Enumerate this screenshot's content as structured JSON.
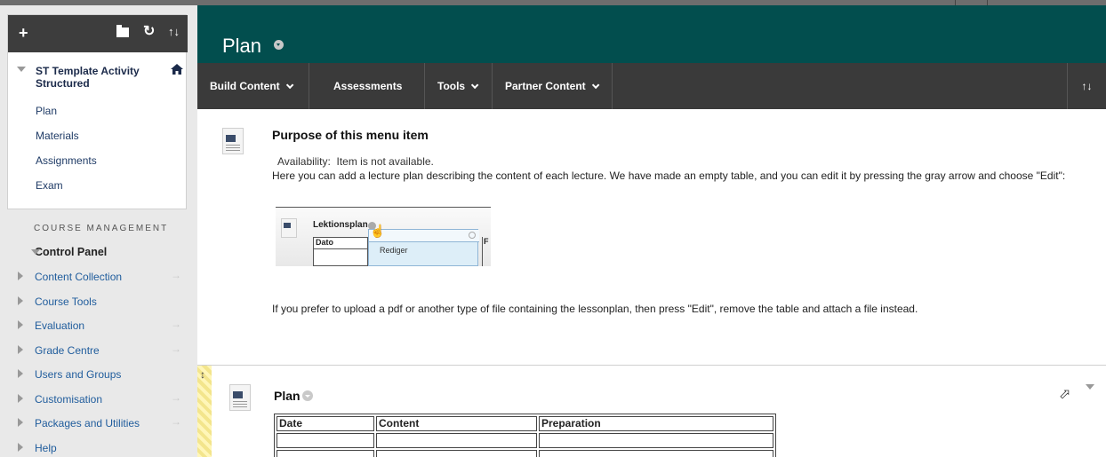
{
  "sidebar": {
    "toolbar": {
      "add_icon": "plus-icon",
      "folder_icon": "folder-icon",
      "refresh_icon": "refresh-icon",
      "sort_icon": "sort-icon"
    },
    "course_title": "ST Template Activity Structured",
    "course_menu": [
      "Plan",
      "Materials",
      "Assignments",
      "Exam"
    ],
    "course_management_label": "COURSE MANAGEMENT",
    "control_panel_label": "Control Panel",
    "control_panel_items": [
      {
        "label": "Content Collection",
        "arrow": "→"
      },
      {
        "label": "Course Tools",
        "arrow": ""
      },
      {
        "label": "Evaluation",
        "arrow": "→"
      },
      {
        "label": "Grade Centre",
        "arrow": "→"
      },
      {
        "label": "Users and Groups",
        "arrow": ""
      },
      {
        "label": "Customisation",
        "arrow": "→"
      },
      {
        "label": "Packages and Utilities",
        "arrow": "→"
      },
      {
        "label": "Help",
        "arrow": ""
      }
    ]
  },
  "header": {
    "title": "Plan"
  },
  "navbar": {
    "items": [
      "Build Content",
      "Assessments",
      "Tools",
      "Partner Content"
    ],
    "sort_label": "↑↓"
  },
  "item1": {
    "title": "Purpose of this menu item",
    "availability_label": "Availability:",
    "availability_value": "Item is not available.",
    "description": "Here you can add a lecture plan describing the content of each lecture. We have made an empty table, and you can edit it by pressing the gray arrow and choose \"Edit\":",
    "thumbnail": {
      "title": "Lektionsplan",
      "col1": "Dato",
      "col2": "F",
      "option": "Rediger"
    },
    "after_text": "If you prefer to upload a pdf or another type of file containing the lessonplan, then press \"Edit\", remove the table and attach a file instead."
  },
  "item2": {
    "title": "Plan",
    "table": {
      "headers": [
        "Date",
        "Content",
        "Preparation"
      ],
      "rows": [
        [
          "",
          "",
          ""
        ],
        [
          "",
          "",
          ""
        ]
      ]
    }
  },
  "colors": {
    "header_bg": "#024e4e",
    "navbar_bg": "#3a3a3a",
    "sidebar_bg": "#e9e9e9",
    "link": "#1f5c9c"
  }
}
